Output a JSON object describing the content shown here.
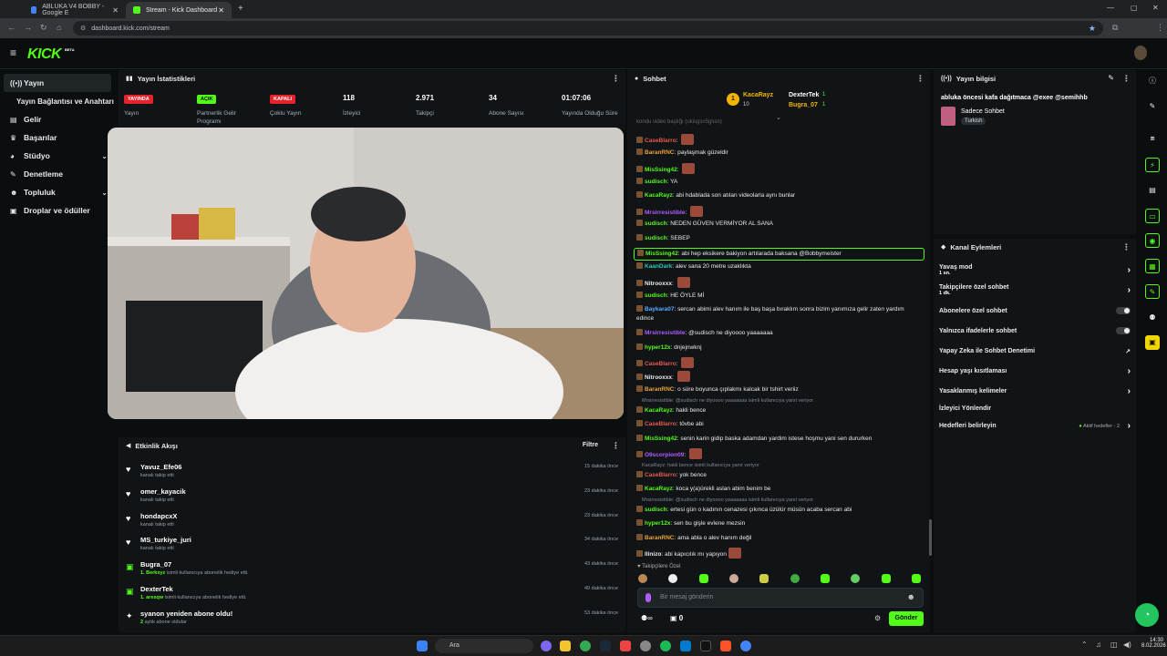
{
  "browser": {
    "tabs": [
      {
        "label": "ABLUKA V4 BOBBY - Google E",
        "fav_color": "#4285f4"
      },
      {
        "label": "Stream - Kick Dashboard",
        "fav_color": "#53fc18"
      }
    ],
    "url": "dashboard.kick.com/stream"
  },
  "brand": {
    "logo": "KICK",
    "beta": "BETA",
    "accent": "#53fc18"
  },
  "sidebar": {
    "items": [
      {
        "label": "Yayın",
        "icon": "broadcast-icon"
      },
      {
        "label": "Yayın Bağlantısı ve Anahtarı",
        "icon": ""
      },
      {
        "label": "Gelir",
        "icon": "money-icon"
      },
      {
        "label": "Başarılar",
        "icon": "trophy-icon"
      },
      {
        "label": "Stüdyo",
        "icon": "palette-icon"
      },
      {
        "label": "Denetleme",
        "icon": "wrench-icon"
      },
      {
        "label": "Topluluk",
        "icon": "people-icon"
      },
      {
        "label": "Droplar ve ödüller",
        "icon": "gift-icon"
      }
    ]
  },
  "stats": {
    "title": "Yayın İstatistikleri",
    "items": [
      {
        "badge": "YAYINDA",
        "label": "Yayın"
      },
      {
        "badge": "AÇIK",
        "label": "Partnerlik Gelir Programı"
      },
      {
        "badge": "KAPALI",
        "label": "Çoklu Yayın"
      },
      {
        "value": "118",
        "label": "İzleyici"
      },
      {
        "value": "2.971",
        "label": "Takipçi"
      },
      {
        "value": "34",
        "label": "Abone Sayısı"
      },
      {
        "value": "01:07:06",
        "label": "Yayında Olduğu Süre"
      }
    ]
  },
  "activity": {
    "title": "Etkinlik Akışı",
    "filter": "Filtre",
    "items": [
      {
        "name": "Yavuz_Efe06",
        "sub": "kanalı takip etti",
        "time": "15 dakika önce",
        "icon": "heart-icon"
      },
      {
        "name": "omer_kayacik",
        "sub": "kanalı takip etti",
        "time": "23 dakika önce",
        "icon": "heart-icon"
      },
      {
        "name": "hondapcxX",
        "sub": "kanalı takip etti",
        "time": "23 dakika önce",
        "icon": "heart-icon"
      },
      {
        "name": "MS_turkiye_juri",
        "sub": "kanalı takip etti",
        "time": "34 dakika önce",
        "icon": "heart-icon"
      },
      {
        "name": "Bugra_07",
        "sub_green": "1. Berkxyz",
        "sub": " isimli kullanıcıya abonelik hediye etti.",
        "time": "43 dakika önce",
        "icon": "gift-icon"
      },
      {
        "name": "DexterTek",
        "sub_green": "1. aresqw",
        "sub": " isimli kullanıcıya abonelik hediye etti.",
        "time": "49 dakika önce",
        "icon": "gift-icon"
      },
      {
        "name": "syanon yeniden abone oldu!",
        "sub_green": "2",
        "sub": " aylık abone oldular",
        "time": "53 dakika önce",
        "icon": "star-icon"
      }
    ]
  },
  "chat": {
    "title": "Sohbet",
    "leaders": [
      {
        "name": "KacaRayz",
        "count": "10"
      },
      {
        "name": "DexterTek",
        "count": "1"
      },
      {
        "name": "Bugra_07",
        "count": "1"
      }
    ],
    "messages": [
      {
        "user": "CaseBlarro",
        "color": "#e85a4f",
        "text": "",
        "emote": true
      },
      {
        "user": "BaranRNC",
        "color": "#e8a23c",
        "text": "paylaşmak güzeldir"
      },
      {
        "user": "MisSsing42",
        "color": "#53fc18",
        "text": "",
        "emote": true
      },
      {
        "user": "sudisch",
        "color": "#53fc18",
        "text": "YA"
      },
      {
        "user": "KacaRayz",
        "color": "#53fc18",
        "text": "abi hdablada son atılan videolarla aynı bunlar"
      },
      {
        "user": "Mrsirresistible",
        "color": "#b15cff",
        "text": "",
        "emote": true
      },
      {
        "user": "sudisch",
        "color": "#53fc18",
        "text": "NEDEN GÜVEN VERMİYOR AL SANA"
      },
      {
        "user": "sudisch",
        "color": "#53fc18",
        "text": "SEBEP"
      },
      {
        "user": "MisSsing42",
        "color": "#53fc18",
        "text": "abi hep eksikere bakiyon artılarada baksana @Bobbymeister"
      },
      {
        "user": "KaanDark",
        "color": "#2ec4b6",
        "text": "alev sana 20 metre uzaklıkta"
      },
      {
        "user": "Nitrooxxx",
        "color": "#e8eaed",
        "text": "",
        "emote": true
      },
      {
        "user": "sudisch",
        "color": "#53fc18",
        "text": "HE ÖYLE Mİ"
      },
      {
        "user": "Baykara07",
        "color": "#5aa9ff",
        "text": "sercan abimi alev hanım ile baş başa bıraklım sonra bizim yanımıza gelir zaten yardım"
      },
      {
        "user": "",
        "color": "",
        "text": "edince"
      },
      {
        "user": "Mrsirresistible",
        "color": "#b15cff",
        "text": "@sudisch ne diyoooo yaaaaaaa"
      },
      {
        "user": "hyper12x",
        "color": "#53fc18",
        "text": "dnjejnwknj"
      },
      {
        "user": "CaseBlarro",
        "color": "#e85a4f",
        "text": "",
        "emote": true
      },
      {
        "user": "Nitrooxxx",
        "color": "#e8eaed",
        "text": "",
        "emote": true
      },
      {
        "user": "BaranRNC",
        "color": "#e8a23c",
        "text": "o süre boyunca çıplakmı kalcak bir tshirt veriiz"
      },
      {
        "user": "KacaRayz",
        "color": "#53fc18",
        "text": "hakli bence"
      },
      {
        "user": "CaseBlarro",
        "color": "#e85a4f",
        "text": "tövbe abi"
      },
      {
        "user": "MisSsing42",
        "color": "#53fc18",
        "text": "senin karin gidip baska adamdan yardim istese hoşmu yani sen dururken"
      },
      {
        "user": "O9scorpion09",
        "color": "#b15cff",
        "text": "",
        "emote": true
      },
      {
        "user": "CaseBlarro",
        "color": "#e85a4f",
        "text": "yok bence"
      },
      {
        "user": "KacaRayz",
        "color": "#53fc18",
        "text": "koca y(a)ürekli aslan abim benim be"
      },
      {
        "user": "sudisch",
        "color": "#53fc18",
        "text": "ertesi gün o kadının cenazesi çıkınca üzülür müsün acaba sercan abi"
      },
      {
        "user": "hyper12x",
        "color": "#53fc18",
        "text": "sen bu gişle evlene mezsin"
      },
      {
        "user": "BaranRNC",
        "color": "#e8a23c",
        "text": "ama abla o alev hanım değil"
      },
      {
        "user": "llinizo",
        "color": "#e8eaed",
        "text": "abi kapıcılık mı yapıyon",
        "emote": true
      }
    ],
    "replies": [
      "Mrsirresistible: @sudisch ne diyoooo yaaaaaaa isimli kullanıcıya yanıt veriyor",
      "KacaRayz: hakli bence isimli kullanıcıya yanıt veriyor",
      "Mrsirresistible: @sudisch ne diyoooo yaaaaaaa isimli kullanıcıya yanıt veriyor"
    ],
    "top_partial": "kondu video başlığı (ukisgsn5gssn)",
    "followers_only": "Takipçilere Özel",
    "input_placeholder": "Bir mesaj gönderin",
    "send": "Gönder",
    "infinite_label": "∞",
    "count_label": "0"
  },
  "stream_info": {
    "title": "Yayın bilgisi",
    "stream_title": "abluka öncesi kafa dağıtmaca @exee @semihhb",
    "category": "Sadece Sohbet",
    "language": "Turkish"
  },
  "channel_actions": {
    "title": "Kanal Eylemleri",
    "items": [
      {
        "label": "Yavaş mod",
        "sub": "1 sn.",
        "control": "arrow"
      },
      {
        "label": "Takipçilere özel sohbet",
        "sub": "1 dk.",
        "control": "arrow"
      },
      {
        "label": "Abonelere özel sohbet",
        "control": "toggle"
      },
      {
        "label": "Yalnızca ifadelerle sohbet",
        "control": "toggle"
      },
      {
        "label": "Yapay Zeka ile Sohbet Denetimi",
        "control": "external"
      },
      {
        "label": "Hesap yaşı kısıtlaması",
        "control": "arrow"
      },
      {
        "label": "Yasaklanmış kelimeler",
        "control": "arrow"
      },
      {
        "label": "İzleyici Yönlendir",
        "control": "none"
      },
      {
        "label": "Hedefleri belirleyin",
        "status": "Aktif hedefler - 2",
        "control": "arrow"
      }
    ]
  },
  "taskbar": {
    "search": "Ara",
    "time": "14:30",
    "date": "8.02.2026"
  }
}
